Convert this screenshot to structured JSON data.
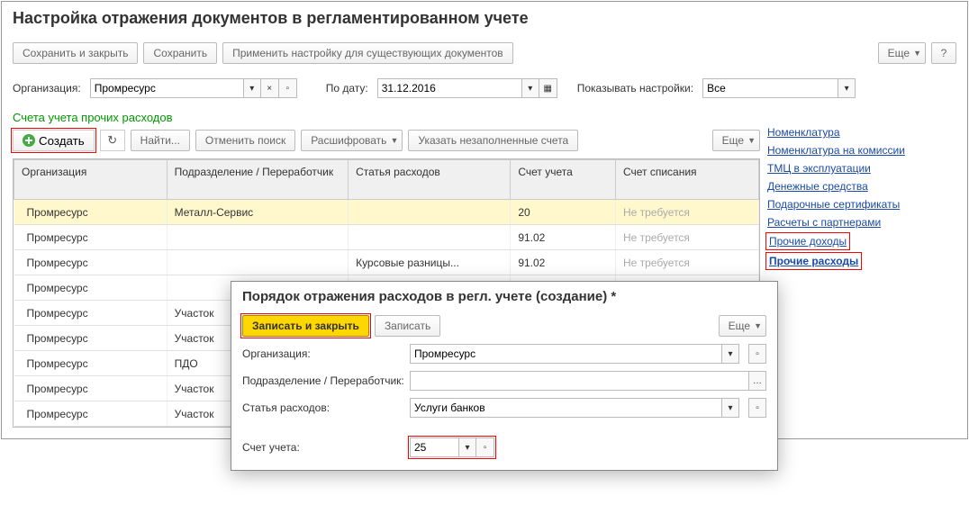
{
  "header": {
    "title": "Настройка отражения документов в регламентированном учете"
  },
  "toolbar": {
    "save_close": "Сохранить и закрыть",
    "save": "Сохранить",
    "apply": "Применить настройку для существующих документов",
    "more": "Еще",
    "help": "?"
  },
  "filters": {
    "org_label": "Организация:",
    "org_value": "Промресурс",
    "date_label": "По дату:",
    "date_value": "31.12.2016",
    "show_label": "Показывать настройки:",
    "show_value": "Все"
  },
  "section": {
    "title": "Счета учета прочих расходов"
  },
  "subtoolbar": {
    "create": "Создать",
    "find": "Найти...",
    "cancel_find": "Отменить поиск",
    "decode": "Расшифровать",
    "show_unfilled": "Указать незаполненные счета",
    "more": "Еще"
  },
  "table": {
    "cols": {
      "org": "Организация",
      "dept": "Подразделение / Переработчик",
      "item": "Статья расходов",
      "acct": "Счет учета",
      "writeoff": "Счет списания"
    },
    "rows": [
      {
        "org": "Промресурс",
        "dept": "Металл-Сервис",
        "item": "",
        "acct": "20",
        "writeoff": "Не требуется",
        "sel": true
      },
      {
        "org": "Промресурс",
        "dept": "",
        "item": "",
        "acct": "91.02",
        "writeoff": "Не требуется"
      },
      {
        "org": "Промресурс",
        "dept": "",
        "item": "Курсовые разницы...",
        "acct": "91.02",
        "writeoff": "Не требуется"
      },
      {
        "org": "Промресурс",
        "dept": "",
        "item": "",
        "acct": "",
        "writeoff": ""
      },
      {
        "org": "Промресурс",
        "dept": "Участок",
        "item": "",
        "acct": "",
        "writeoff": ""
      },
      {
        "org": "Промресурс",
        "dept": "Участок",
        "item": "",
        "acct": "",
        "writeoff": ""
      },
      {
        "org": "Промресурс",
        "dept": "ПДО",
        "item": "",
        "acct": "",
        "writeoff": ""
      },
      {
        "org": "Промресурс",
        "dept": "Участок",
        "item": "",
        "acct": "",
        "writeoff": ""
      },
      {
        "org": "Промресурс",
        "dept": "Участок",
        "item": "",
        "acct": "",
        "writeoff": ""
      }
    ]
  },
  "links": {
    "l1": "Номенклатура",
    "l2": "Номенклатура на комиссии",
    "l3": "ТМЦ в эксплуатации",
    "l4": "Денежные средства",
    "l5": "Подарочные сертификаты",
    "l6": "Расчеты с партнерами",
    "l7": "Прочие доходы",
    "l8": "Прочие расходы"
  },
  "dialog": {
    "title": "Порядок отражения расходов в регл. учете (создание) *",
    "save_close": "Записать и закрыть",
    "save": "Записать",
    "more": "Еще",
    "org_label": "Организация:",
    "org_value": "Промресурс",
    "dept_label": "Подразделение / Переработчик:",
    "dept_value": "",
    "item_label": "Статья расходов:",
    "item_value": "Услуги банков",
    "acct_label": "Счет учета:",
    "acct_value": "25"
  }
}
